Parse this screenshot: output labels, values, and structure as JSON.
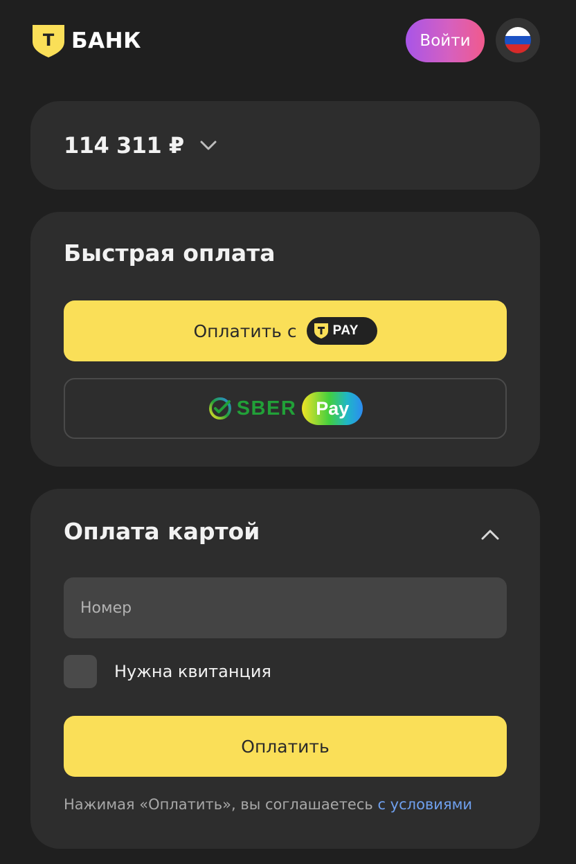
{
  "header": {
    "logo_text": "БАНК",
    "logo_letter": "Т",
    "login_label": "Войти",
    "language_icon": "russia-flag-icon"
  },
  "amount": {
    "value": "114 311 ₽",
    "expand_icon": "chevron-down-icon"
  },
  "fast_payment": {
    "title": "Быстрая оплата",
    "tpay_label": "Оплатить с",
    "tpay_logo_text": "PAY",
    "sber_text": "SBER",
    "sber_pay_text": "Pay"
  },
  "card_payment": {
    "title": "Оплата картой",
    "collapse_icon": "chevron-up-icon",
    "number_placeholder": "Номер",
    "receipt_label": "Нужна квитанция",
    "pay_label": "Оплатить",
    "terms_text": "Нажимая «Оплатить», вы соглашаетесь ",
    "terms_link": "с условиями"
  },
  "colors": {
    "background": "#1f1f1f",
    "card": "#2d2d2d",
    "brand_yellow": "#fadf58",
    "link": "#6fa0ee",
    "sber_green": "#21a038"
  }
}
